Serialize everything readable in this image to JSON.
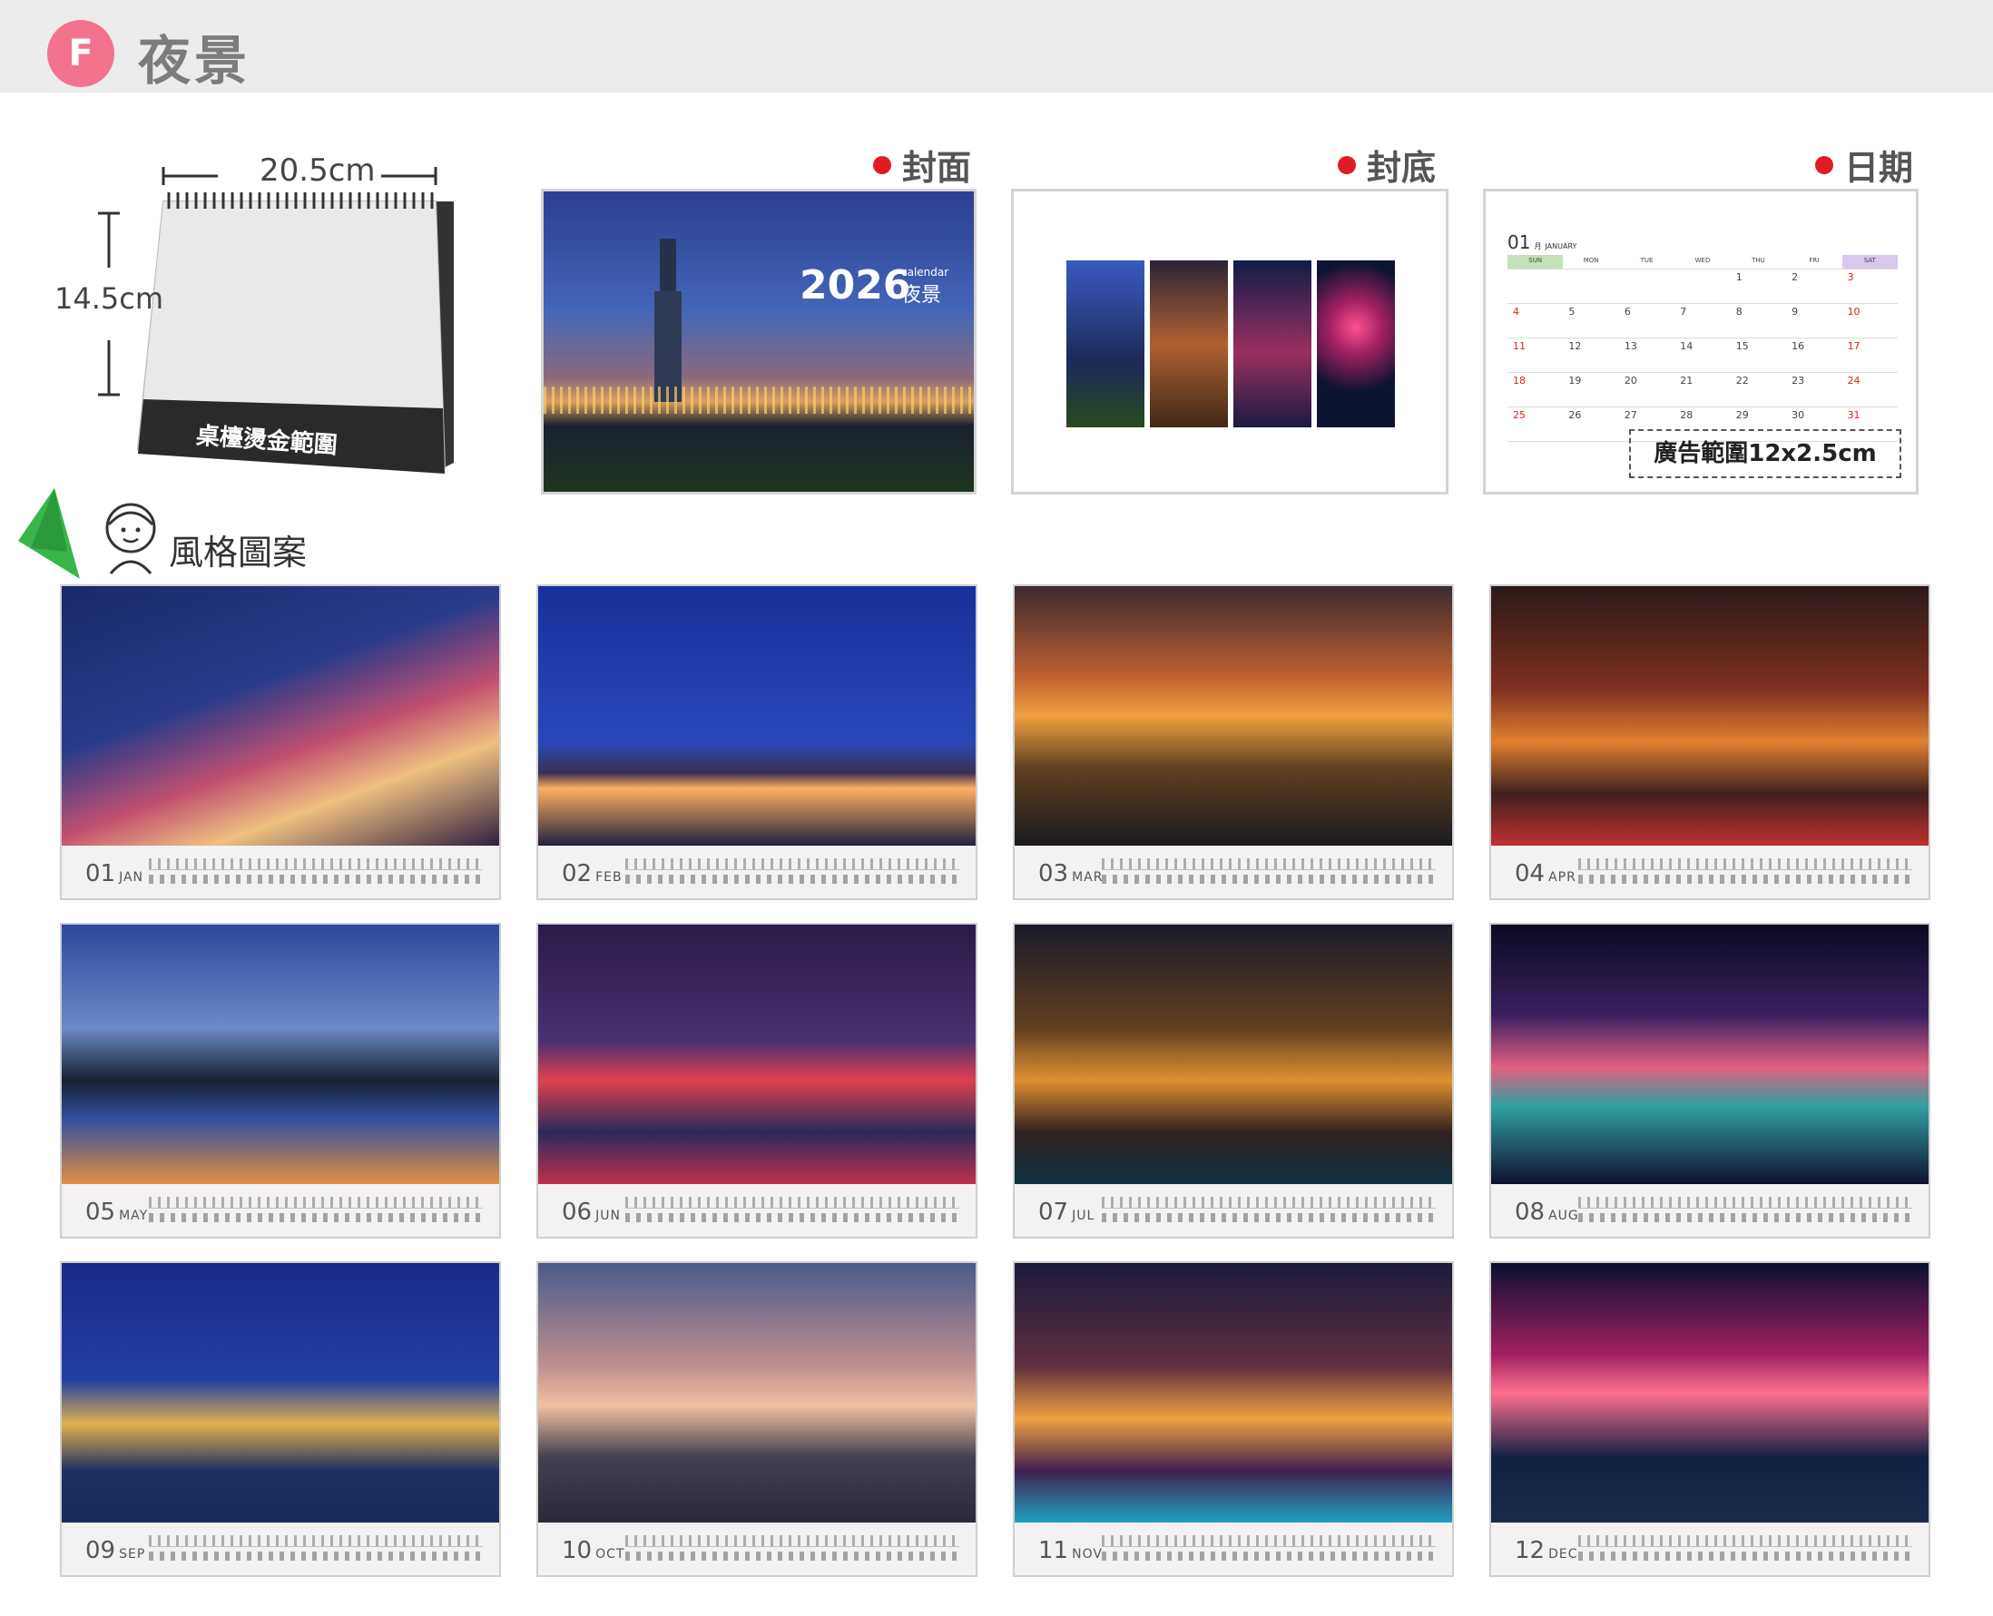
{
  "header": {
    "badge": "F",
    "title": "夜景"
  },
  "mockup": {
    "width": "20.5cm",
    "height": "14.5cm",
    "hot_stamp": "桌檯燙金範圍"
  },
  "sections": {
    "cover": "封面",
    "back": "封底",
    "date": "日期",
    "style": "風格圖案"
  },
  "cover": {
    "year": "2026",
    "calendar": "calendar",
    "theme": "夜景"
  },
  "date_page": {
    "month_num": "01",
    "month_unit": "月",
    "month_name": "JANUARY",
    "weekdays": [
      "SUN",
      "MON",
      "TUE",
      "WED",
      "THU",
      "FRI",
      "SAT"
    ],
    "weeks": [
      [
        "",
        "",
        "",
        "",
        "1",
        "2",
        "3"
      ],
      [
        "4",
        "5",
        "6",
        "7",
        "8",
        "9",
        "10"
      ],
      [
        "11",
        "12",
        "13",
        "14",
        "15",
        "16",
        "17"
      ],
      [
        "18",
        "19",
        "20",
        "21",
        "22",
        "23",
        "24"
      ],
      [
        "25",
        "26",
        "27",
        "28",
        "29",
        "30",
        "31"
      ]
    ],
    "ad_area": "廣告範圍12x2.5cm"
  },
  "months": [
    {
      "num": "01",
      "name": "JAN"
    },
    {
      "num": "02",
      "name": "FEB"
    },
    {
      "num": "03",
      "name": "MAR"
    },
    {
      "num": "04",
      "name": "APR"
    },
    {
      "num": "05",
      "name": "MAY"
    },
    {
      "num": "06",
      "name": "JUN"
    },
    {
      "num": "07",
      "name": "JUL"
    },
    {
      "num": "08",
      "name": "AUG"
    },
    {
      "num": "09",
      "name": "SEP"
    },
    {
      "num": "10",
      "name": "OCT"
    },
    {
      "num": "11",
      "name": "NOV"
    },
    {
      "num": "12",
      "name": "DEC"
    }
  ],
  "colors": {
    "badge": "#f3738f",
    "accent_red": "#e21b23",
    "header_bg": "#ececec",
    "gold_band": "#2a2a2a"
  }
}
